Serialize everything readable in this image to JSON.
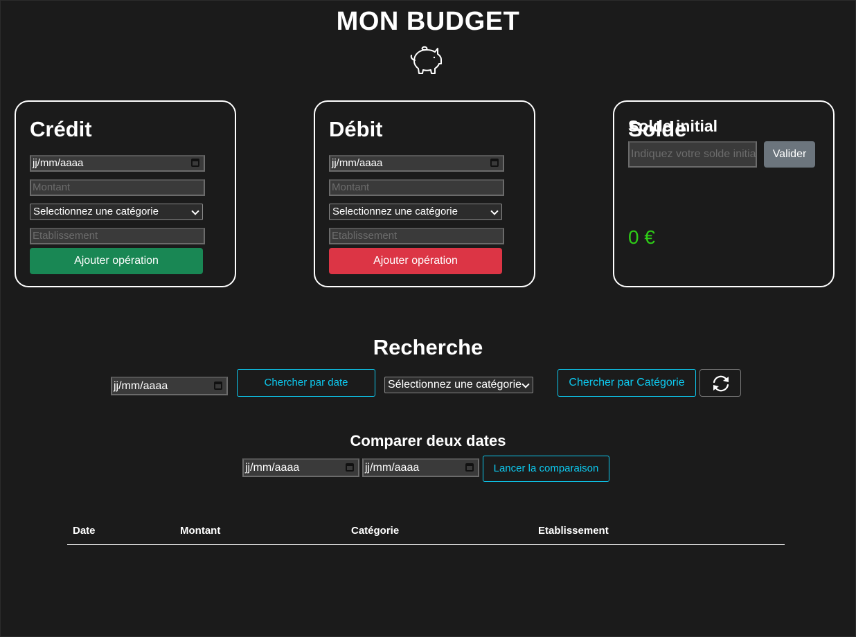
{
  "header": {
    "title": "MON BUDGET",
    "logo_icon": "piggy-bank-icon"
  },
  "credit": {
    "title": "Crédit",
    "date_placeholder": "jj/mm/aaaa",
    "amount_placeholder": "Montant",
    "category_selected": "Selectionnez une catégorie",
    "establishment_placeholder": "Etablissement",
    "submit_label": "Ajouter opération",
    "submit_color": "#198754"
  },
  "debit": {
    "title": "Débit",
    "date_placeholder": "jj/mm/aaaa",
    "amount_placeholder": "Montant",
    "category_selected": "Selectionnez une catégorie",
    "establishment_placeholder": "Etablissement",
    "submit_label": "Ajouter opération",
    "submit_color": "#dc3545"
  },
  "balance": {
    "initial_label": "Solde initial",
    "initial_placeholder": "Indiquez votre solde initial",
    "validate_label": "Valider",
    "title": "Solde",
    "value": "0 €",
    "value_color": "#2ecc17"
  },
  "search": {
    "title": "Recherche",
    "date_placeholder": "jj/mm/aaaa",
    "search_date_label": "Chercher par date",
    "category_selected": "Sélectionnez une catégorie",
    "search_category_label": "Chercher par Catégorie",
    "refresh_icon": "refresh-icon",
    "accent_color": "#0dcaf0"
  },
  "compare": {
    "title": "Comparer deux dates",
    "date1_placeholder": "jj/mm/aaaa",
    "date2_placeholder": "jj/mm/aaaa",
    "submit_label": "Lancer la comparaison"
  },
  "table": {
    "columns": [
      "Date",
      "Montant",
      "Catégorie",
      "Etablissement"
    ],
    "rows": []
  }
}
